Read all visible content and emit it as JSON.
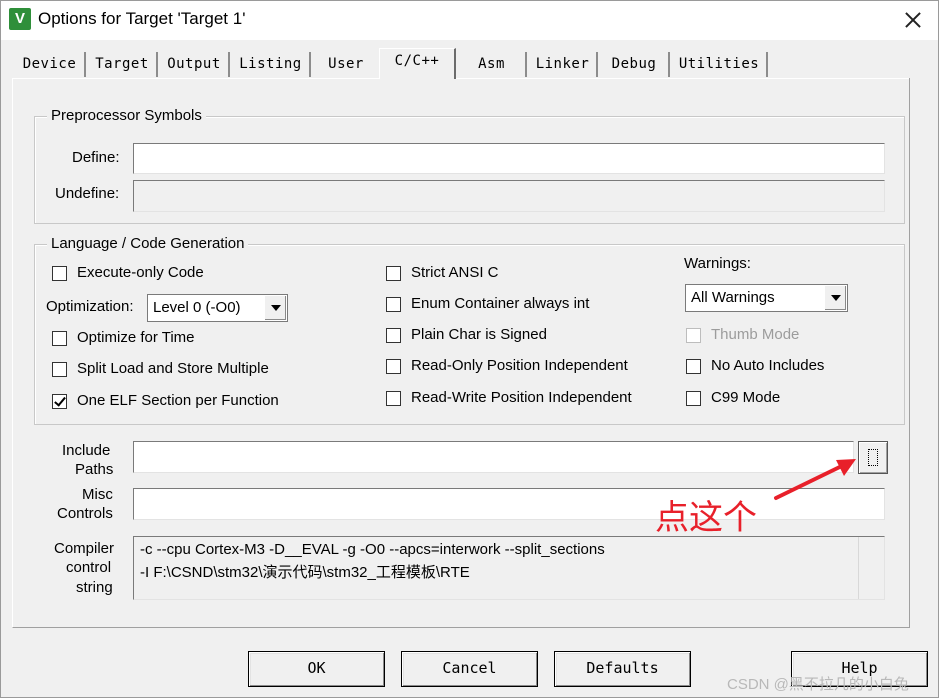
{
  "window": {
    "title": "Options for Target 'Target 1'",
    "icon_label": "V"
  },
  "tabs": [
    {
      "label": "Device"
    },
    {
      "label": "Target"
    },
    {
      "label": "Output"
    },
    {
      "label": "Listing"
    },
    {
      "label": "User"
    },
    {
      "label": "C/C++",
      "active": true
    },
    {
      "label": "Asm"
    },
    {
      "label": "Linker"
    },
    {
      "label": "Debug"
    },
    {
      "label": "Utilities"
    }
  ],
  "preprocessor": {
    "title": "Preprocessor Symbols",
    "define_label": "Define:",
    "define_value": "",
    "undefine_label": "Undefine:",
    "undefine_value": ""
  },
  "codegen": {
    "title": "Language / Code Generation",
    "execute_only": {
      "label": "Execute-only Code",
      "checked": false
    },
    "optimization_label": "Optimization:",
    "optimization_value": "Level 0 (-O0)",
    "optimize_time": {
      "label": "Optimize for Time",
      "checked": false
    },
    "split_load": {
      "label": "Split Load and Store Multiple",
      "checked": false
    },
    "one_elf": {
      "label": "One ELF Section per Function",
      "checked": true
    },
    "strict_ansi": {
      "label": "Strict ANSI C",
      "checked": false
    },
    "enum_container": {
      "label": "Enum Container always int",
      "checked": false
    },
    "plain_char": {
      "label": "Plain Char is Signed",
      "checked": false
    },
    "ro_pi": {
      "label": "Read-Only Position Independent",
      "checked": false
    },
    "rw_pi": {
      "label": "Read-Write Position Independent",
      "checked": false
    },
    "warnings_label": "Warnings:",
    "warnings_value": "All Warnings",
    "thumb_mode": {
      "label": "Thumb Mode",
      "checked": false,
      "disabled": true
    },
    "no_auto_includes": {
      "label": "No Auto Includes",
      "checked": false
    },
    "c99_mode": {
      "label": "C99 Mode",
      "checked": false
    }
  },
  "paths": {
    "include_label_1": "Include",
    "include_label_2": "Paths",
    "include_value": "",
    "misc_label_1": "Misc",
    "misc_label_2": "Controls",
    "misc_value": ""
  },
  "compiler": {
    "label_1": "Compiler",
    "label_2": "control",
    "label_3": "string",
    "line_1": "-c --cpu Cortex-M3 -D__EVAL -g -O0 --apcs=interwork --split_sections",
    "line_2": "-I F:\\CSND\\stm32\\演示代码\\stm32_工程模板\\RTE"
  },
  "buttons": {
    "ok": "OK",
    "cancel": "Cancel",
    "defaults": "Defaults",
    "help": "Help"
  },
  "annotation": {
    "text": "点这个",
    "color": "#e8202a"
  },
  "watermark": "CSDN @黑不拉几的小白兔"
}
